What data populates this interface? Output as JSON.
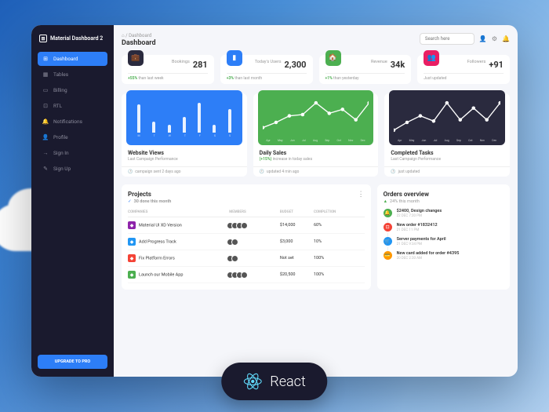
{
  "brand": "Material Dashboard 2",
  "nav": [
    {
      "icon": "⊞",
      "label": "Dashboard",
      "active": true
    },
    {
      "icon": "▦",
      "label": "Tables"
    },
    {
      "icon": "▭",
      "label": "Billing"
    },
    {
      "icon": "⊡",
      "label": "RTL"
    },
    {
      "icon": "🔔",
      "label": "Notifications"
    },
    {
      "icon": "👤",
      "label": "Profile"
    },
    {
      "icon": "→",
      "label": "Sign In"
    },
    {
      "icon": "✎",
      "label": "Sign Up"
    }
  ],
  "upgrade": "UPGRADE TO PRO",
  "breadcrumb": {
    "path": "⌂ / Dashboard",
    "title": "Dashboard"
  },
  "search": {
    "placeholder": "Search here"
  },
  "stats": [
    {
      "icon": "💼",
      "color": "dark",
      "label": "Bookings",
      "value": "281",
      "foot_pct": "+55%",
      "foot_txt": "than last week"
    },
    {
      "icon": "▮",
      "color": "blue",
      "label": "Today's Users",
      "value": "2,300",
      "foot_pct": "+3%",
      "foot_txt": "than last month"
    },
    {
      "icon": "🏠",
      "color": "green",
      "label": "Revenue",
      "value": "34k",
      "foot_pct": "+1%",
      "foot_txt": "than yesterday"
    },
    {
      "icon": "👥",
      "color": "pink",
      "label": "Followers",
      "value": "+91",
      "foot_pct": "",
      "foot_txt": "Just updated"
    }
  ],
  "charts": [
    {
      "title": "Website Views",
      "sub": "Last Campaign Performance",
      "foot": "campaign sent 2 days ago",
      "color": "blue",
      "type": "bar"
    },
    {
      "title": "Daily Sales",
      "sub_pct": "(+15%)",
      "sub": "increase in today sales",
      "foot": "updated 4 min ago",
      "color": "green",
      "type": "line"
    },
    {
      "title": "Completed Tasks",
      "sub": "Last Campaign Performance",
      "foot": "just updated",
      "color": "dark",
      "type": "line"
    }
  ],
  "chart_data": [
    {
      "type": "bar",
      "categories": [
        "M",
        "T",
        "W",
        "T",
        "F",
        "S",
        "S"
      ],
      "values": [
        45,
        18,
        12,
        25,
        48,
        12,
        38
      ],
      "ylim": [
        0,
        60
      ]
    },
    {
      "type": "line",
      "categories": [
        "Apr",
        "May",
        "Jun",
        "Jul",
        "Aug",
        "Sep",
        "Oct",
        "Nov",
        "Dec"
      ],
      "values": [
        100,
        180,
        280,
        300,
        480,
        320,
        380,
        220,
        480
      ],
      "ylim": [
        0,
        600
      ]
    },
    {
      "type": "line",
      "categories": [
        "Apr",
        "May",
        "Jun",
        "Jul",
        "Aug",
        "Sep",
        "Oct",
        "Nov",
        "Dec"
      ],
      "values": [
        60,
        180,
        280,
        200,
        480,
        220,
        400,
        220,
        480
      ],
      "ylim": [
        0,
        600
      ]
    }
  ],
  "projects": {
    "title": "Projects",
    "sub": "30 done this month",
    "cols": [
      "COMPANIES",
      "MEMBERS",
      "BUDGET",
      "COMPLETION"
    ],
    "rows": [
      {
        "icon_bg": "#8e24aa",
        "name": "Material UI XD Version",
        "members": 4,
        "budget": "$14,000",
        "completion": 60
      },
      {
        "icon_bg": "#2196f3",
        "name": "Add Progress Track",
        "members": 2,
        "budget": "$3,000",
        "completion": 10
      },
      {
        "icon_bg": "#f44336",
        "name": "Fix Platform Errors",
        "members": 2,
        "budget": "Not set",
        "completion": 100
      },
      {
        "icon_bg": "#4caf50",
        "name": "Launch our Mobile App",
        "members": 4,
        "budget": "$20,500",
        "completion": 100
      }
    ]
  },
  "orders": {
    "title": "Orders overview",
    "sub": "24% this month",
    "items": [
      {
        "color": "#4caf50",
        "icon": "🔔",
        "text": "$2400, Design changes",
        "date": "22 DEC 7:20 PM"
      },
      {
        "color": "#f44336",
        "icon": "⊡",
        "text": "New order #1832412",
        "date": "21 DEC 11 PM"
      },
      {
        "color": "#2196f3",
        "icon": "🛒",
        "text": "Server payments for April",
        "date": "21 DEC 9:34 PM"
      },
      {
        "color": "#ff9800",
        "icon": "💳",
        "text": "New card added for order #4395",
        "date": "20 DEC 2:20 AM"
      }
    ]
  },
  "badge": "React"
}
